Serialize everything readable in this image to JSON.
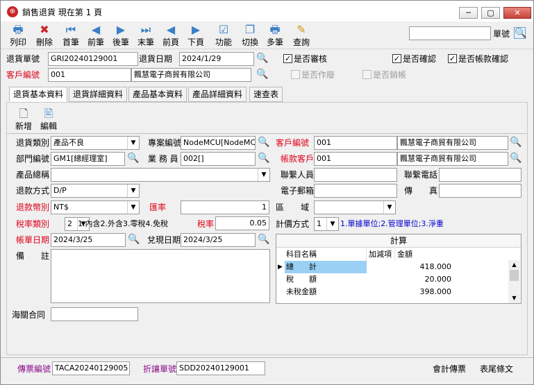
{
  "window": {
    "title": "銷售退貨   現在第 1 頁",
    "icon_glyph": "⊕"
  },
  "toolbar": {
    "buttons": [
      {
        "label": "列印",
        "glyph": "🖶"
      },
      {
        "label": "刪除",
        "glyph": "✖"
      },
      {
        "label": "首筆",
        "glyph": "⏮"
      },
      {
        "label": "前筆",
        "glyph": "◀"
      },
      {
        "label": "後筆",
        "glyph": "▶"
      },
      {
        "label": "末筆",
        "glyph": "⏭"
      },
      {
        "label": "前頁",
        "glyph": "◀"
      },
      {
        "label": "下頁",
        "glyph": "▶"
      },
      {
        "label": "功能",
        "glyph": "☑"
      },
      {
        "label": "切換",
        "glyph": "❐"
      },
      {
        "label": "多筆",
        "glyph": "🖶"
      },
      {
        "label": "查詢",
        "glyph": "✎"
      }
    ],
    "search_value": "",
    "search_label": "單號",
    "search_glyph": "🔍"
  },
  "header": {
    "return_no_label": "退貨單號",
    "return_no": "GRI20240129001",
    "return_date_label": "退貨日期",
    "return_date": "2024/1/29",
    "customer_label": "客戶編號",
    "customer_code": "001",
    "customer_name": "飄慧電子商貿有限公司",
    "mag_glyph": "🔍",
    "checks": {
      "audited": {
        "label": "是否審核",
        "checked": "✓"
      },
      "confirmed": {
        "label": "是否確認",
        "checked": "✓"
      },
      "ar_confirmed": {
        "label": "是否帳款確認",
        "checked": "✓"
      },
      "voided": {
        "label": "是否作廢",
        "checked": ""
      },
      "closed": {
        "label": "是否銷帳",
        "checked": ""
      }
    }
  },
  "tabs": [
    "退貨基本資料",
    "退貨詳細資料",
    "產品基本資料",
    "產品詳細資料",
    "速查表"
  ],
  "subtools": [
    {
      "label": "新增",
      "glyph": "🗋"
    },
    {
      "label": "編輯",
      "glyph": "🖹"
    }
  ],
  "form": {
    "return_type_label": "退貨類別",
    "return_type": "產品不良",
    "project_label": "專案編號",
    "project": "NodeMCU[NodeMCU開",
    "cust_code_label": "客戶編號",
    "cust_code": "001",
    "cust_name": "飄慧電子商貿有限公司",
    "dept_label": "部門編號",
    "dept": "GM1[總經理室]",
    "sales_label": "業 務 員",
    "sales": "002[]",
    "ar_cust_label": "帳款客戶",
    "ar_cust_code": "001",
    "ar_cust_name": "飄慧電子商貿有限公司",
    "product_label": "產品總稱",
    "product": "",
    "contact_label": "聯繫人員",
    "contact": "",
    "phone_label": "聯繫電話",
    "phone": "",
    "refund_label": "退款方式",
    "refund": "D/P",
    "email_label": "電子郵箱",
    "email": "",
    "fax_label": "傳　　真",
    "fax": "",
    "currency_label": "退款幣別",
    "currency": "NT$",
    "rate_label": "匯率",
    "rate": "1",
    "region_label": "區　　域",
    "region": "",
    "tax_type_label": "稅率類別",
    "tax_type": "2",
    "tax_type_hint": "1.內含2.外含3.零稅4.免稅",
    "tax_rate_label": "稅率",
    "tax_rate": "0.05",
    "price_method_label": "計價方式",
    "price_method": "1",
    "price_method_hint": "1.單據單位;2.管理單位;3.淨重",
    "ar_date_label": "帳單日期",
    "ar_date": "2024/3/25",
    "cash_date_label": "兌現日期",
    "cash_date": "2024/3/25",
    "note_label": "備　　註",
    "note": "",
    "customs_label": "海關合同",
    "customs": ""
  },
  "calc": {
    "title": "計算",
    "columns": [
      "科目名稱",
      "加減項",
      "金額"
    ],
    "rows": [
      {
        "name": "總　　計",
        "op": "",
        "amount": "418.000"
      },
      {
        "name": "稅　　額",
        "op": "",
        "amount": "20.000"
      },
      {
        "name": "未稅金額",
        "op": "",
        "amount": "398.000"
      }
    ],
    "row_pointer": "▶",
    "scroll_up": "▲",
    "scroll_down": "▼"
  },
  "footer": {
    "voucher_label": "傳票編號",
    "voucher": "TACA20240129005",
    "discount_label": "折讓單號",
    "discount": "SDD20240129001",
    "accounting_voucher": "會計傳票",
    "end_text": "表尾條文"
  }
}
